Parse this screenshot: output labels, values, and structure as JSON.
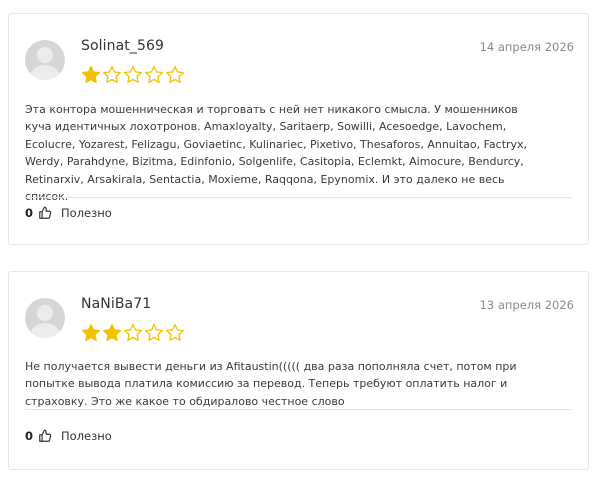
{
  "reviews": [
    {
      "username": "Solinat_569",
      "date": "14 апреля 2026",
      "rating": 1,
      "max_rating": 5,
      "text": "Эта контора мошенническая и торговать с ней нет никакого смысла. У мошенников куча идентичных лохотронов. Amaxloyalty, Saritaerp, Sowilli, Acesoedge, Lavochem, Ecolucre, Yozarest, Felizagu, Goviaetinc, Kulinariec, Pixetivo, Thesaforos, Annuitao, Factryx, Werdy, Parahdyne, Bizitma, Edinfonio, Solgenlife, Casitopia, Eclemkt, Aimocure, Bendurcy, Retinarxiv, Arsakirala, Sentactia, Moxieme, Raqqona, Epynomix. И это далеко не весь список.",
      "helpful_count": "0",
      "helpful_label": "Полезно"
    },
    {
      "username": "NaNiBa71",
      "date": "13 апреля 2026",
      "rating": 2,
      "max_rating": 5,
      "text": "Не получается вывести деньги из Afitaustin((((( два раза пополняла счет, потом при попытке вывода платила комиссию за перевод. Теперь требуют оплатить налог и страховку. Это же какое то обдиралово честное слово",
      "helpful_count": "0",
      "helpful_label": "Полезно"
    }
  ],
  "colors": {
    "star_filled": "#f2c200",
    "star_empty_stroke": "#f2c200",
    "divider": "#e4e4e4",
    "date": "#8a8a8a"
  },
  "icons": {
    "avatar": "avatar-placeholder-icon",
    "star": "star-icon",
    "thumb": "thumbs-up-icon"
  }
}
